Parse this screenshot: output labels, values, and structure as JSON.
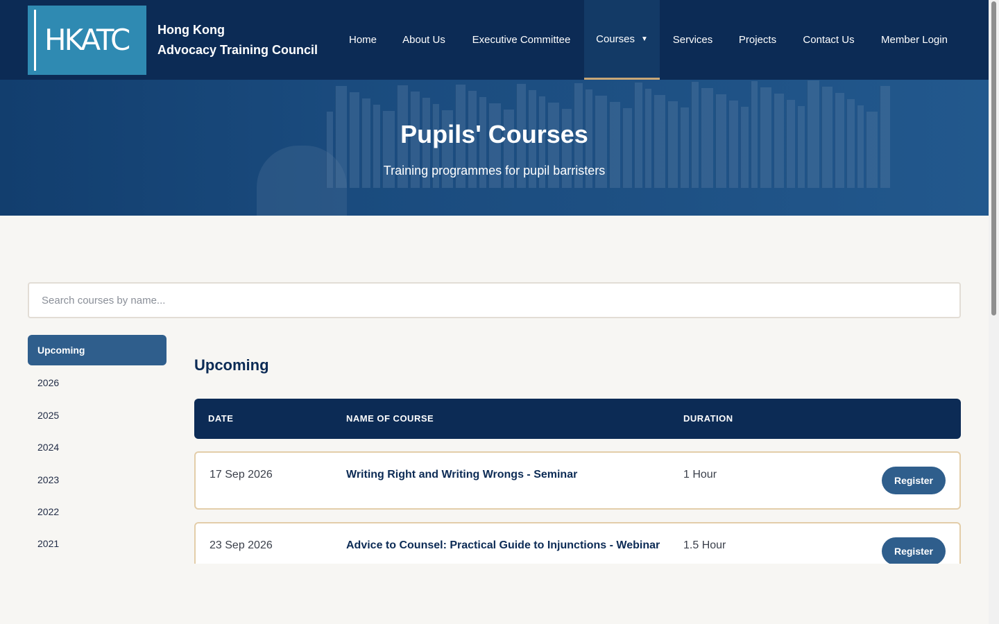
{
  "header": {
    "logo_text": "HKATC",
    "org_line1": "Hong Kong",
    "org_line2": "Advocacy Training Council",
    "nav": [
      {
        "label": "Home"
      },
      {
        "label": "About Us"
      },
      {
        "label": "Executive Committee"
      },
      {
        "label": "Courses",
        "active": true
      },
      {
        "label": "Services"
      },
      {
        "label": "Projects"
      },
      {
        "label": "Contact Us"
      },
      {
        "label": "Member Login"
      }
    ],
    "caret_icon": "caret-down-icon"
  },
  "hero": {
    "title": "Pupils' Courses",
    "subtitle": "Training programmes for pupil barristers"
  },
  "search": {
    "placeholder": "Search courses by name..."
  },
  "sidebar": {
    "items": [
      {
        "label": "Upcoming",
        "active": true
      },
      {
        "label": "2026"
      },
      {
        "label": "2025"
      },
      {
        "label": "2024"
      },
      {
        "label": "2023"
      },
      {
        "label": "2022"
      },
      {
        "label": "2021"
      }
    ]
  },
  "content": {
    "section_title": "Upcoming",
    "columns": [
      "DATE",
      "NAME OF COURSE",
      "DURATION"
    ],
    "rows": [
      {
        "date": "17 Sep 2026",
        "name": "Writing Right and Writing Wrongs - Seminar",
        "duration": "1 Hour",
        "action": "Register"
      },
      {
        "date": "23 Sep 2026",
        "name": "Advice to Counsel: Practical Guide to Injunctions - Webinar",
        "duration": "1.5 Hour",
        "action": "Register"
      }
    ]
  },
  "colors": {
    "navy": "#0c2b55",
    "accent_blue": "#2f5e8c",
    "logo_blue": "#2f8ab2",
    "gold_border": "#e3cda9",
    "page_bg": "#f7f6f3"
  }
}
